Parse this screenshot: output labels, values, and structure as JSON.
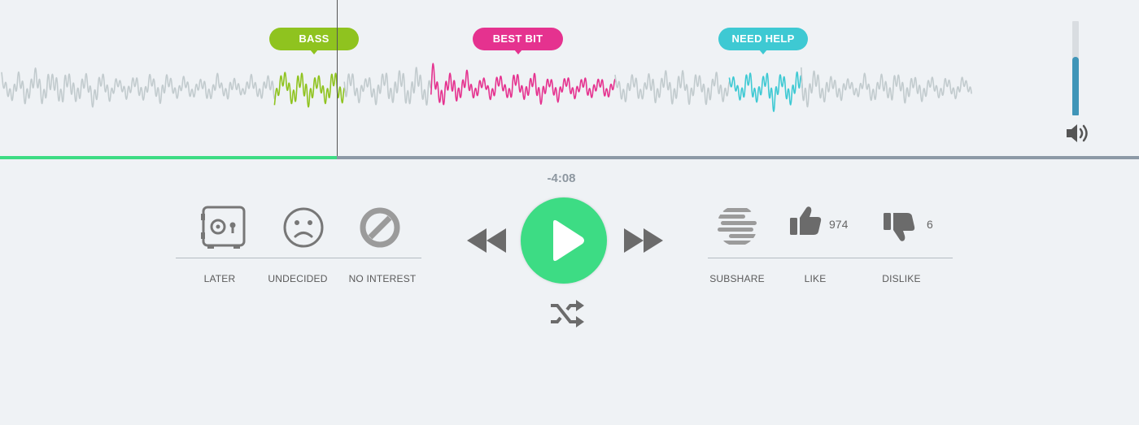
{
  "waveform": {
    "markers": [
      {
        "label": "BASS",
        "color": "#8fc31f"
      },
      {
        "label": "BEST BIT",
        "color": "#e5328f"
      },
      {
        "label": "NEED HELP",
        "color": "#3ec9d3"
      }
    ],
    "base_color": "#c2cbce",
    "progress_fraction": 0.296,
    "progress_color": "#3ddc84"
  },
  "volume": {
    "level": 0.62
  },
  "player": {
    "time_remaining": "-4:08"
  },
  "left_actions": [
    {
      "label": "LATER",
      "icon": "safe-icon"
    },
    {
      "label": "UNDECIDED",
      "icon": "sad-face-icon"
    },
    {
      "label": "NO INTEREST",
      "icon": "no-interest-icon"
    }
  ],
  "right_actions": [
    {
      "label": "SUBSHARE",
      "icon": "subshare-icon"
    },
    {
      "label": "LIKE",
      "icon": "thumbs-up-icon",
      "count": "974"
    },
    {
      "label": "DISLIKE",
      "icon": "thumbs-down-icon",
      "count": "6"
    }
  ]
}
